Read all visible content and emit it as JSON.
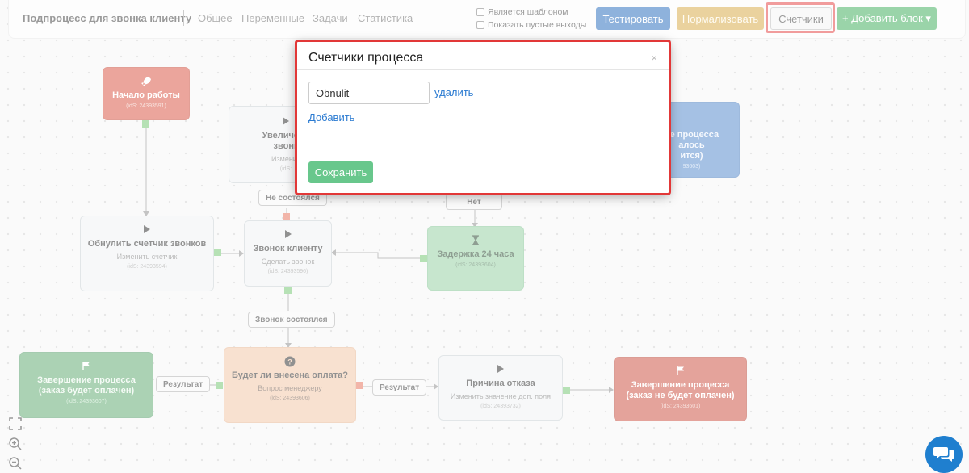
{
  "toolbar": {
    "title": "Подпроцесс для звонка клиенту",
    "nav": [
      "Общее",
      "Переменные",
      "Задачи",
      "Статистика"
    ],
    "checkbox_template": "Является шаблоном",
    "checkbox_empty_outputs": "Показать пустые выходы",
    "btn_test": "Тестировать",
    "btn_normalize": "Нормализовать",
    "btn_counters": "Счетчики",
    "btn_add_block": "+ Добавить блок ▾"
  },
  "colors": {
    "highlight": "#e23838",
    "primary": "#1d64b8",
    "warning": "#d4a53d",
    "success": "#34a853",
    "link": "#2a7ad1"
  },
  "nodes": {
    "start": {
      "icon": "rocket-icon",
      "title": "Начало работы",
      "id": "(idS: 24393591)"
    },
    "increase": {
      "icon": "play-icon",
      "title1": "Увеличени",
      "title2": "звонк",
      "sub": "Изменит",
      "id": "(idS:"
    },
    "reset": {
      "icon": "play-icon",
      "title": "Обнулить счетчик звонков",
      "sub": "Изменить счетчик",
      "id": "(idS: 24393594)"
    },
    "call": {
      "icon": "play-icon",
      "title": "Звонок клиенту",
      "sub": "Сделать звонок",
      "id": "(idS: 24393596)"
    },
    "delay": {
      "icon": "hourglass-icon",
      "title": "Задержка 24 часа",
      "id": "(idS: 24393604)"
    },
    "blue_end": {
      "line1": "ие процесса",
      "line2": "алось",
      "line3": "ится)",
      "id": "93603)"
    },
    "end_paid": {
      "icon": "flag-icon",
      "title": "Завершение процесса (заказ будет оплачен)",
      "id": "(idS: 24393607)"
    },
    "will_pay": {
      "icon": "question-icon",
      "title": "Будет ли внесена оплата?",
      "sub": "Вопрос менеджеру",
      "id": "(idS: 24393606)"
    },
    "reason": {
      "icon": "play-icon",
      "title": "Причина отказа",
      "sub": "Изменить значение доп. поля",
      "id": "(idS: 24393732)"
    },
    "end_unpaid": {
      "icon": "flag-icon",
      "title": "Завершение процесса (заказ не будет оплачен)",
      "id": "(idS: 24393601)"
    }
  },
  "labels": {
    "not_happened": "Не состоялся",
    "no": "Нет",
    "happened": "Звонок состоялся",
    "result_left": "Результат",
    "result_right": "Результат"
  },
  "modal": {
    "title": "Счетчики процесса",
    "close": "×",
    "counter_value": "Obnulit",
    "delete_link": "удалить",
    "add_link": "Добавить",
    "save_button": "Сохранить"
  }
}
